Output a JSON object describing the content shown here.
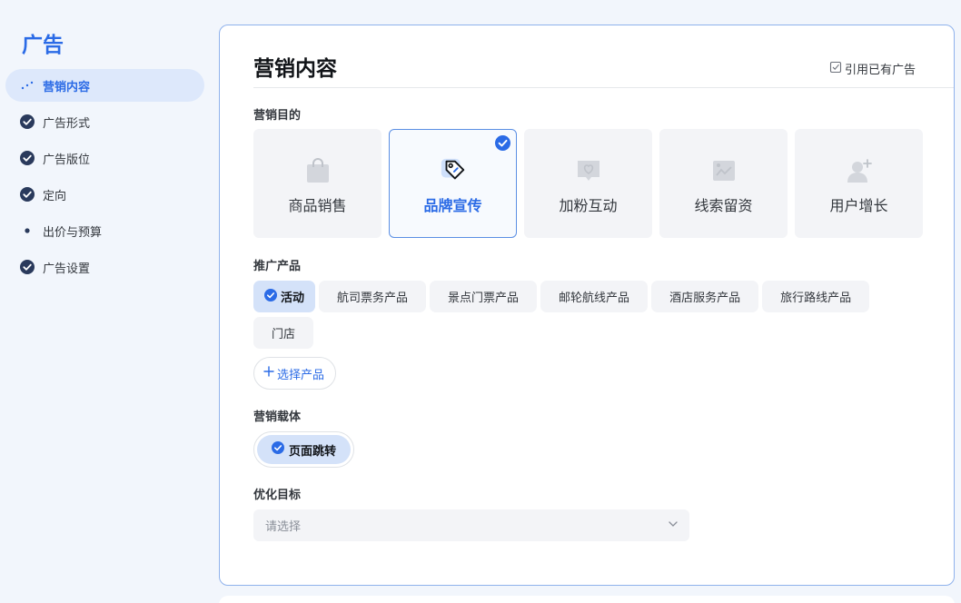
{
  "sidebar": {
    "title": "广告",
    "items": [
      {
        "label": "营销内容",
        "state": "active"
      },
      {
        "label": "广告形式",
        "state": "done"
      },
      {
        "label": "广告版位",
        "state": "done"
      },
      {
        "label": "定向",
        "state": "done"
      },
      {
        "label": "出价与预算",
        "state": "pending"
      },
      {
        "label": "广告设置",
        "state": "done"
      }
    ]
  },
  "main": {
    "title": "营销内容",
    "reference_link": "引用已有广告",
    "goal": {
      "label": "营销目的",
      "options": [
        {
          "label": "商品销售",
          "icon": "shopping-bag-icon"
        },
        {
          "label": "品牌宣传",
          "icon": "brand-tag-icon",
          "selected": true
        },
        {
          "label": "加粉互动",
          "icon": "heart-chat-icon"
        },
        {
          "label": "线索留资",
          "icon": "lead-image-icon"
        },
        {
          "label": "用户增长",
          "icon": "user-plus-icon"
        }
      ]
    },
    "product": {
      "label": "推广产品",
      "chips": [
        {
          "label": "活动",
          "selected": true
        },
        {
          "label": "航司票务产品"
        },
        {
          "label": "景点门票产品"
        },
        {
          "label": "邮轮航线产品"
        },
        {
          "label": "酒店服务产品"
        },
        {
          "label": "旅行路线产品"
        },
        {
          "label": "门店"
        }
      ],
      "add_label": "选择产品"
    },
    "carrier": {
      "label": "营销载体",
      "value": "页面跳转"
    },
    "optimize": {
      "label": "优化目标",
      "placeholder": "请选择"
    }
  },
  "colors": {
    "accent": "#2b6be6",
    "check_done": "#2a3a5c",
    "selected_chip_bg": "#d4e2f9",
    "page_bg": "#f2f6fc"
  }
}
